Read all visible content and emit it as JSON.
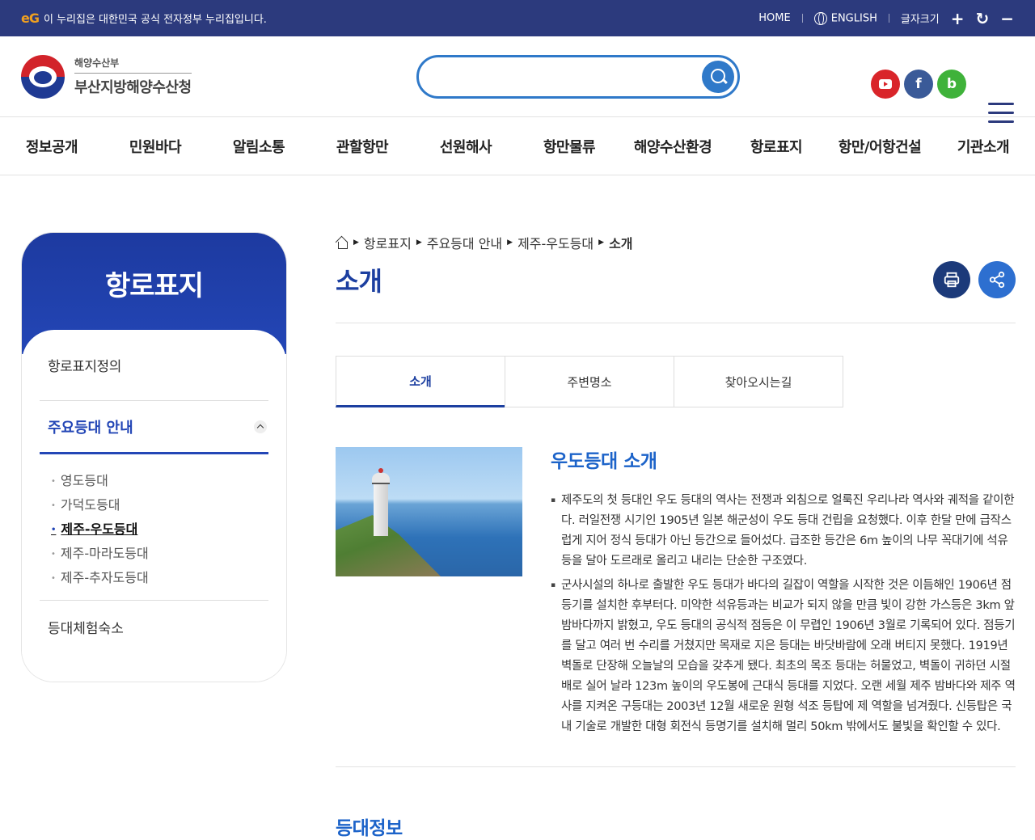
{
  "govbar": {
    "logo": "eG",
    "notice": "이 누리집은 대한민국 공식 전자정부 누리집입니다.",
    "home": "HOME",
    "english": "ENGLISH",
    "font_size": "글자크기",
    "font_plus": "+",
    "font_reset": "↻",
    "font_minus": "−"
  },
  "header": {
    "ministry": "해양수산부",
    "office": "부산지방해양수산청",
    "search_placeholder": "",
    "social": [
      "youtube-icon",
      "facebook-icon",
      "blog-icon"
    ],
    "facebook_glyph": "f",
    "blog_glyph": "b"
  },
  "gnb": [
    "정보공개",
    "민원바다",
    "알림소통",
    "관할항만",
    "선원해사",
    "항만물류",
    "해양수산환경",
    "항로표지",
    "항만/어항건설",
    "기관소개"
  ],
  "lnb": {
    "title": "항로표지",
    "item1": "항로표지정의",
    "active": "주요등대 안내",
    "sub": [
      "영도등대",
      "가덕도등대",
      "제주-우도등대",
      "제주-마라도등대",
      "제주-추자도등대"
    ],
    "last": "등대체험숙소"
  },
  "breadcrumb": [
    "항로표지",
    "주요등대 안내",
    "제주-우도등대",
    "소개"
  ],
  "page_title": "소개",
  "tabs": [
    "소개",
    "주변명소",
    "찾아오시는길"
  ],
  "intro": {
    "heading": "우도등대 소개",
    "paragraphs": [
      "제주도의 첫 등대인 우도 등대의 역사는 전쟁과 외침으로 얼룩진 우리나라 역사와 궤적을 같이한다. 러일전쟁 시기인 1905년 일본 해군성이 우도 등대 건립을 요청했다. 이후 한달 만에 급작스럽게 지어 정식 등대가 아닌 등간으로 들어섰다. 급조한 등간은 6m 높이의 나무 꼭대기에 석유등을 달아 도르래로 올리고 내리는 단순한 구조였다.",
      "군사시설의 하나로 출발한 우도 등대가 바다의 길잡이 역할을 시작한 것은 이듬해인 1906년 점등기를 설치한 후부터다. 미약한 석유등과는 비교가 되지 않을 만큼 빛이 강한 가스등은 3km 앞 밤바다까지 밝혔고, 우도 등대의 공식적 점등은 이 무렵인 1906년 3월로 기록되어 있다. 점등기를 달고 여러 번 수리를 거쳤지만 목재로 지은 등대는 바닷바람에 오래 버티지 못했다. 1919년 벽돌로 단장해 오늘날의 모습을 갖추게 됐다. 최초의 목조 등대는 허물었고, 벽돌이 귀하던 시절 배로 실어 날라 123m 높이의 우도봉에 근대식 등대를 지었다. 오랜 세월 제주 밤바다와 제주 역사를 지켜온 구등대는 2003년 12월 새로운 원형 석조 등탑에 제 역할을 넘겨줬다. 신등탑은 국내 기술로 개발한 대형 회전식 등명기를 설치해 멀리 50km 밖에서도 불빛을 확인할 수 있다."
    ]
  },
  "section2": "등대정보"
}
